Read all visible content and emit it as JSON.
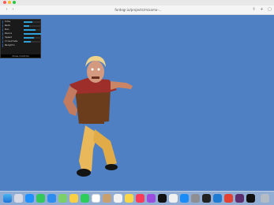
{
  "browser": {
    "url": "fordegr.io/projects/mixamo-..."
  },
  "gui": {
    "rows": [
      {
        "label": "Idle",
        "fill": 0.5
      },
      {
        "label": "Walk",
        "fill": 0.3
      },
      {
        "label": "Run",
        "fill": 0.7
      },
      {
        "label": "Dance",
        "fill": 1.0
      },
      {
        "label": "Speed",
        "fill": 0.6
      },
      {
        "label": "",
        "fill": 0.0
      },
      {
        "label": "Crossfade",
        "fill": 0.4
      },
      {
        "label": "",
        "fill": 0.0
      },
      {
        "label": "Weights",
        "fill": 0.0
      }
    ],
    "close_label": "Close Controls"
  },
  "dock": {
    "icons": [
      "finder-icon",
      "launchpad-icon",
      "safari-icon",
      "messages-icon",
      "mail-icon",
      "maps-icon",
      "photos-icon",
      "facetime-icon",
      "calendar-icon",
      "contacts-icon",
      "reminders-icon",
      "notes-icon",
      "music-icon",
      "podcasts-icon",
      "tv-icon",
      "news-icon",
      "appstore-icon",
      "settings-icon",
      "terminal-icon",
      "vscode-icon",
      "chrome-icon",
      "slack-icon",
      "figma-icon",
      "trash-icon"
    ]
  },
  "colors": {
    "background": "#4f80c3",
    "gui_bg": "#1a1a1a",
    "slider": "#2fa1d6"
  }
}
